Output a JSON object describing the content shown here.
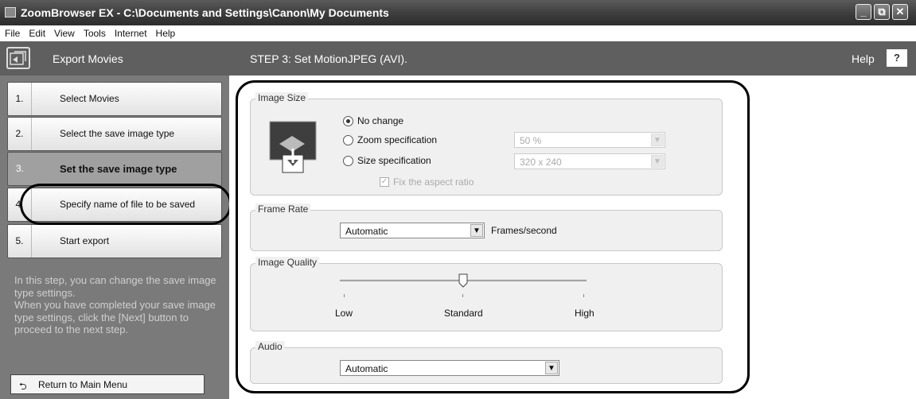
{
  "window": {
    "title": "ZoomBrowser EX  -  C:\\Documents and Settings\\Canon\\My Documents",
    "minimize": "_",
    "restore": "⧉",
    "close": "✕"
  },
  "menu": [
    "File",
    "Edit",
    "View",
    "Tools",
    "Internet",
    "Help"
  ],
  "header": {
    "section": "Export Movies",
    "step_title": "STEP 3: Set MotionJPEG (AVI).",
    "help_label": "Help",
    "help_button": "?"
  },
  "steps": [
    {
      "num": "1.",
      "label": "Select Movies"
    },
    {
      "num": "2.",
      "label": "Select the save image type"
    },
    {
      "num": "3.",
      "label": "Set the save image type"
    },
    {
      "num": "4.",
      "label": "Specify name of file to be saved"
    },
    {
      "num": "5.",
      "label": "Start export"
    }
  ],
  "active_step": 3,
  "sidebar": {
    "description": "In this step, you can change the save image type settings.\n When you have completed your save image type settings, click the [Next] button to proceed to the next step.",
    "return_label": "Return to Main Menu"
  },
  "image_size": {
    "label": "Image Size",
    "options": {
      "no_change": "No change",
      "zoom": "Zoom specification",
      "size": "Size specification"
    },
    "selected": "No change",
    "zoom_value": "50 %",
    "size_value": "320 x 240",
    "fix_aspect": "Fix the aspect ratio",
    "fix_aspect_checked": true
  },
  "frame_rate": {
    "label": "Frame Rate",
    "value": "Automatic",
    "unit": "Frames/second"
  },
  "image_quality": {
    "label": "Image Quality",
    "low": "Low",
    "standard": "Standard",
    "high": "High",
    "level": 0.5
  },
  "audio": {
    "label": "Audio",
    "value": "Automatic"
  },
  "icons": {
    "app": "zoombrowser-app-icon",
    "section": "export-movies-icon",
    "image_size": "image-resize-icon",
    "return": "return-arrow-icon",
    "dropdown": "chevron-down-icon"
  },
  "colors": {
    "sidebar_bg": "#7a7a7a",
    "header_bg": "#5f5f5f",
    "group_bg": "#f0f0f0"
  }
}
